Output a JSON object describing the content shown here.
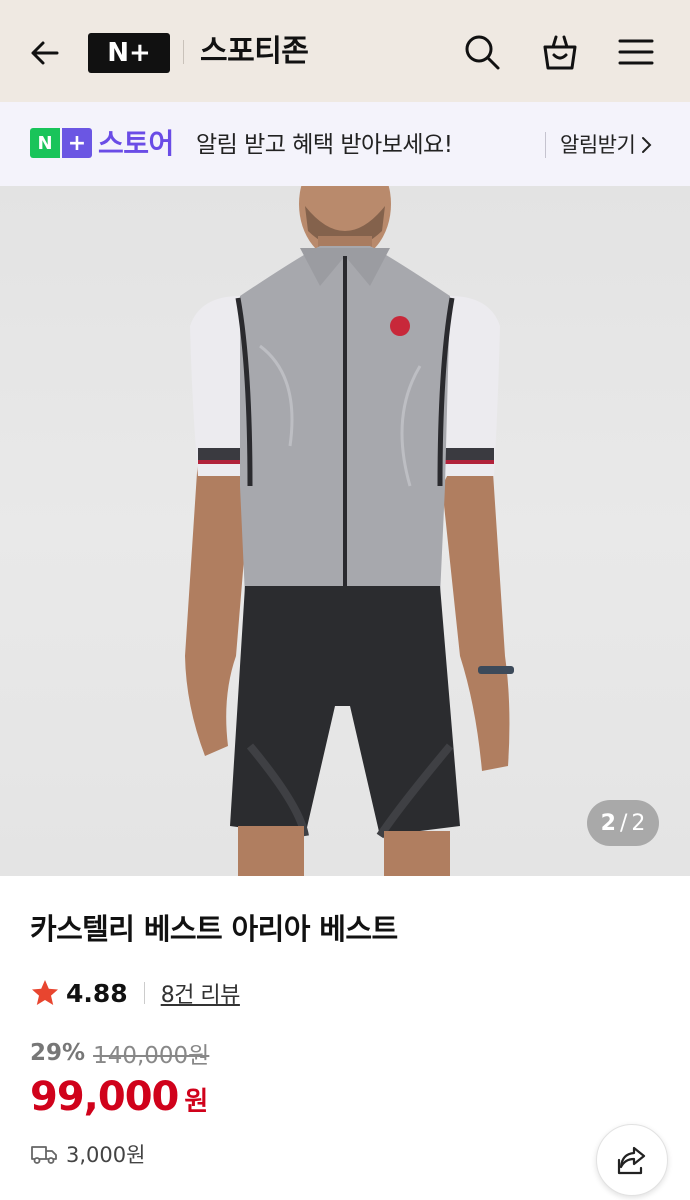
{
  "header": {
    "logo_text": "N+",
    "store_name": "스포티존"
  },
  "promo": {
    "logo_text": "N+",
    "store_label": "스토어",
    "message": "알림 받고 혜택 받아보세요!",
    "action_label": "알림받기"
  },
  "gallery": {
    "current": "2",
    "separator": "/",
    "total": "2"
  },
  "product": {
    "title": "카스텔리 베스트 아리아 베스트",
    "rating": "4.88",
    "reviews": "8건 리뷰",
    "discount": "29%",
    "original_price": "140,000원",
    "price": "99,000",
    "price_unit": "원",
    "shipping": "3,000원"
  },
  "colors": {
    "accent_red": "#d0021b",
    "naver_green": "#19c45a",
    "store_purple": "#6a4ce6",
    "star": "#e8452f"
  },
  "icons": [
    "back-arrow-icon",
    "search-icon",
    "shopping-bag-icon",
    "menu-icon",
    "chevron-right-icon",
    "star-icon",
    "delivery-truck-icon",
    "share-icon"
  ]
}
